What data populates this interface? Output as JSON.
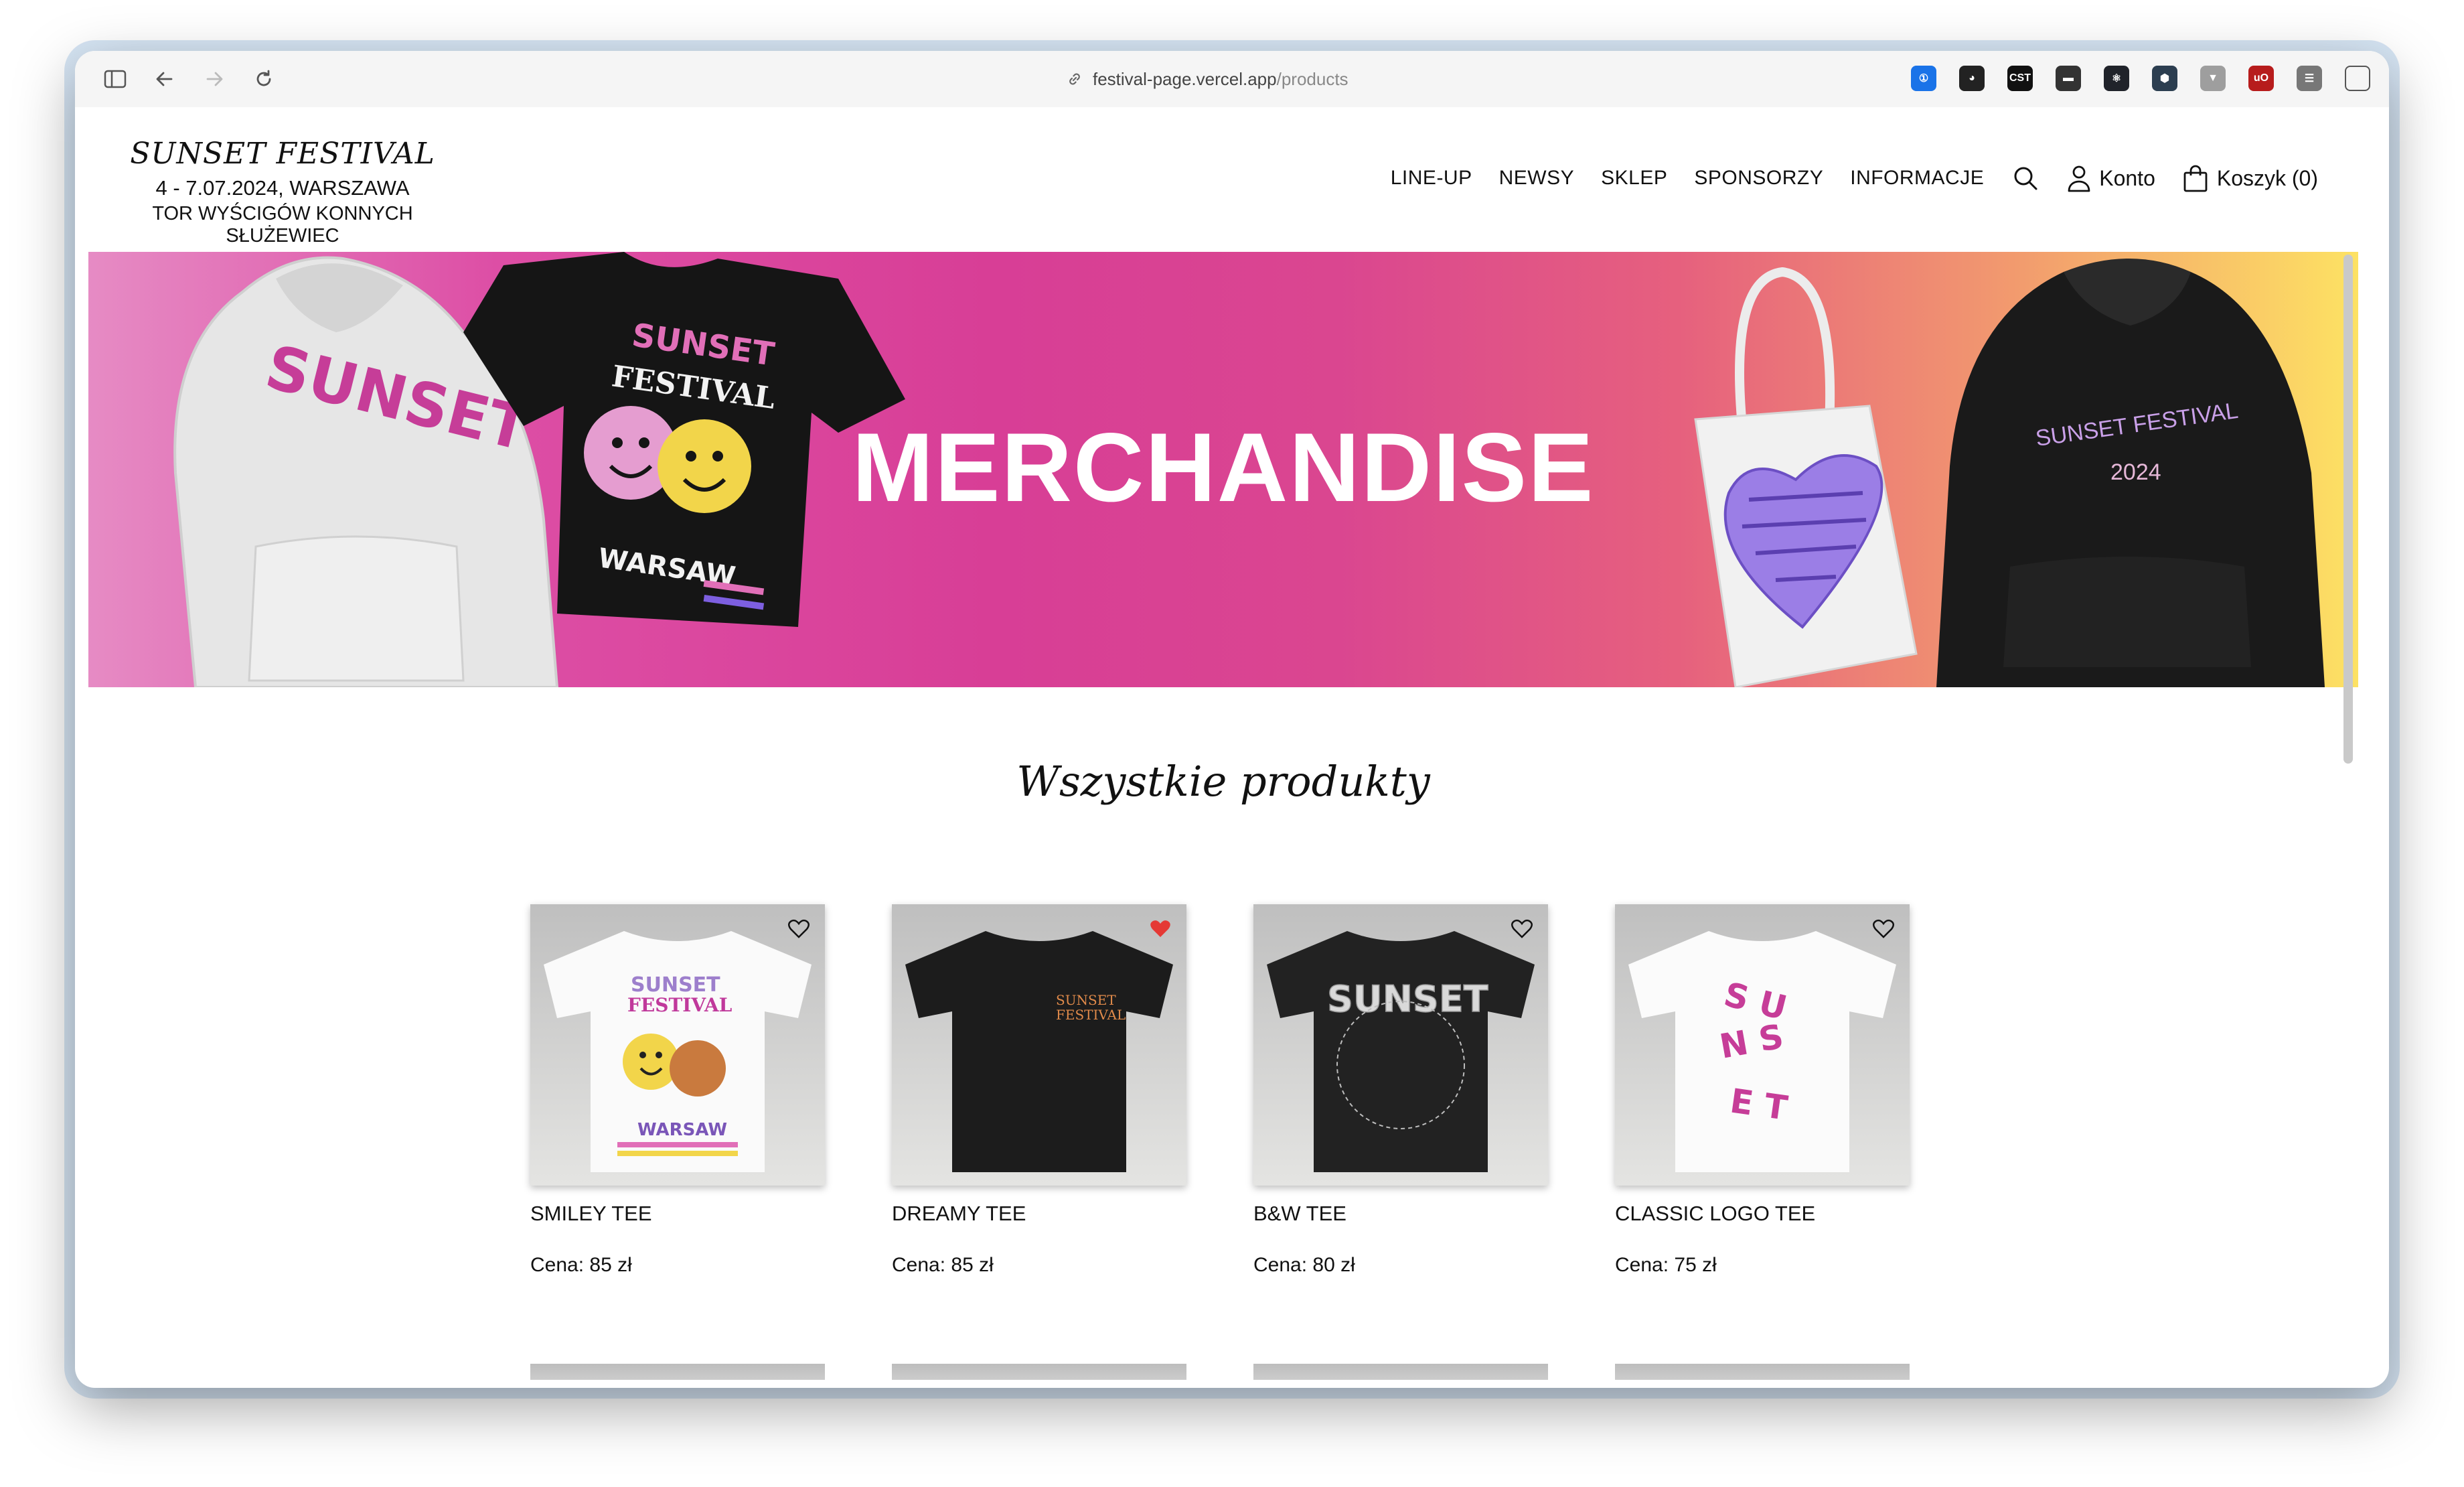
{
  "browser": {
    "url_host": "festival-page.vercel.app",
    "url_path": "/products",
    "extensions": [
      {
        "name": "1password-icon",
        "label": "①",
        "color": "#1a73e8"
      },
      {
        "name": "panda-icon",
        "label": "◕",
        "color": "#222222"
      },
      {
        "name": "cst-icon",
        "label": "CST",
        "color": "#111111"
      },
      {
        "name": "terminal-icon",
        "label": "▬",
        "color": "#333333"
      },
      {
        "name": "react-icon",
        "label": "⚛",
        "color": "#20232a"
      },
      {
        "name": "hexagon-icon",
        "label": "⬢",
        "color": "#2c3e50"
      },
      {
        "name": "vue-icon",
        "label": "▼",
        "color": "#9e9e9e"
      },
      {
        "name": "ublock-icon",
        "label": "uO",
        "color": "#b71c1c"
      },
      {
        "name": "list-icon",
        "label": "☰",
        "color": "#777777"
      }
    ]
  },
  "header": {
    "brand_name": "SUNSET FESTIVAL",
    "dates": "4 - 7.07.2024, WARSZAWA",
    "venue": "TOR WYŚCIGÓW KONNYCH SŁUŻEWIEC",
    "menu": [
      "LINE-UP",
      "NEWSY",
      "SKLEP",
      "SPONSORZY",
      "INFORMACJE"
    ],
    "account_label": "Konto",
    "cart_label": "Koszyk (0)"
  },
  "banner": {
    "title": "MERCHANDISE",
    "hoodie_left_text": "SUNSET",
    "tee_text_top": "SUNSET",
    "tee_text_mid": "FESTIVAL",
    "tee_text_bottom": "WARSAW",
    "hoodie_right_text_1": "SUNSET FESTIVAL",
    "hoodie_right_text_2": "2024"
  },
  "section_title": "Wszystkie produkty",
  "products": [
    {
      "name": "SMILEY TEE",
      "price": "Cena: 85 zł",
      "favorite": false,
      "shirt": "#ffffff"
    },
    {
      "name": "DREAMY TEE",
      "price": "Cena: 85 zł",
      "favorite": true,
      "shirt": "#1c1c1c"
    },
    {
      "name": "B&W TEE",
      "price": "Cena: 80 zł",
      "favorite": false,
      "shirt": "#222222"
    },
    {
      "name": "CLASSIC LOGO TEE",
      "price": "Cena: 75 zł",
      "favorite": false,
      "shirt": "#ffffff"
    }
  ],
  "colors": {
    "favorite_heart": "#e53935",
    "heart_outline": "#111111"
  }
}
